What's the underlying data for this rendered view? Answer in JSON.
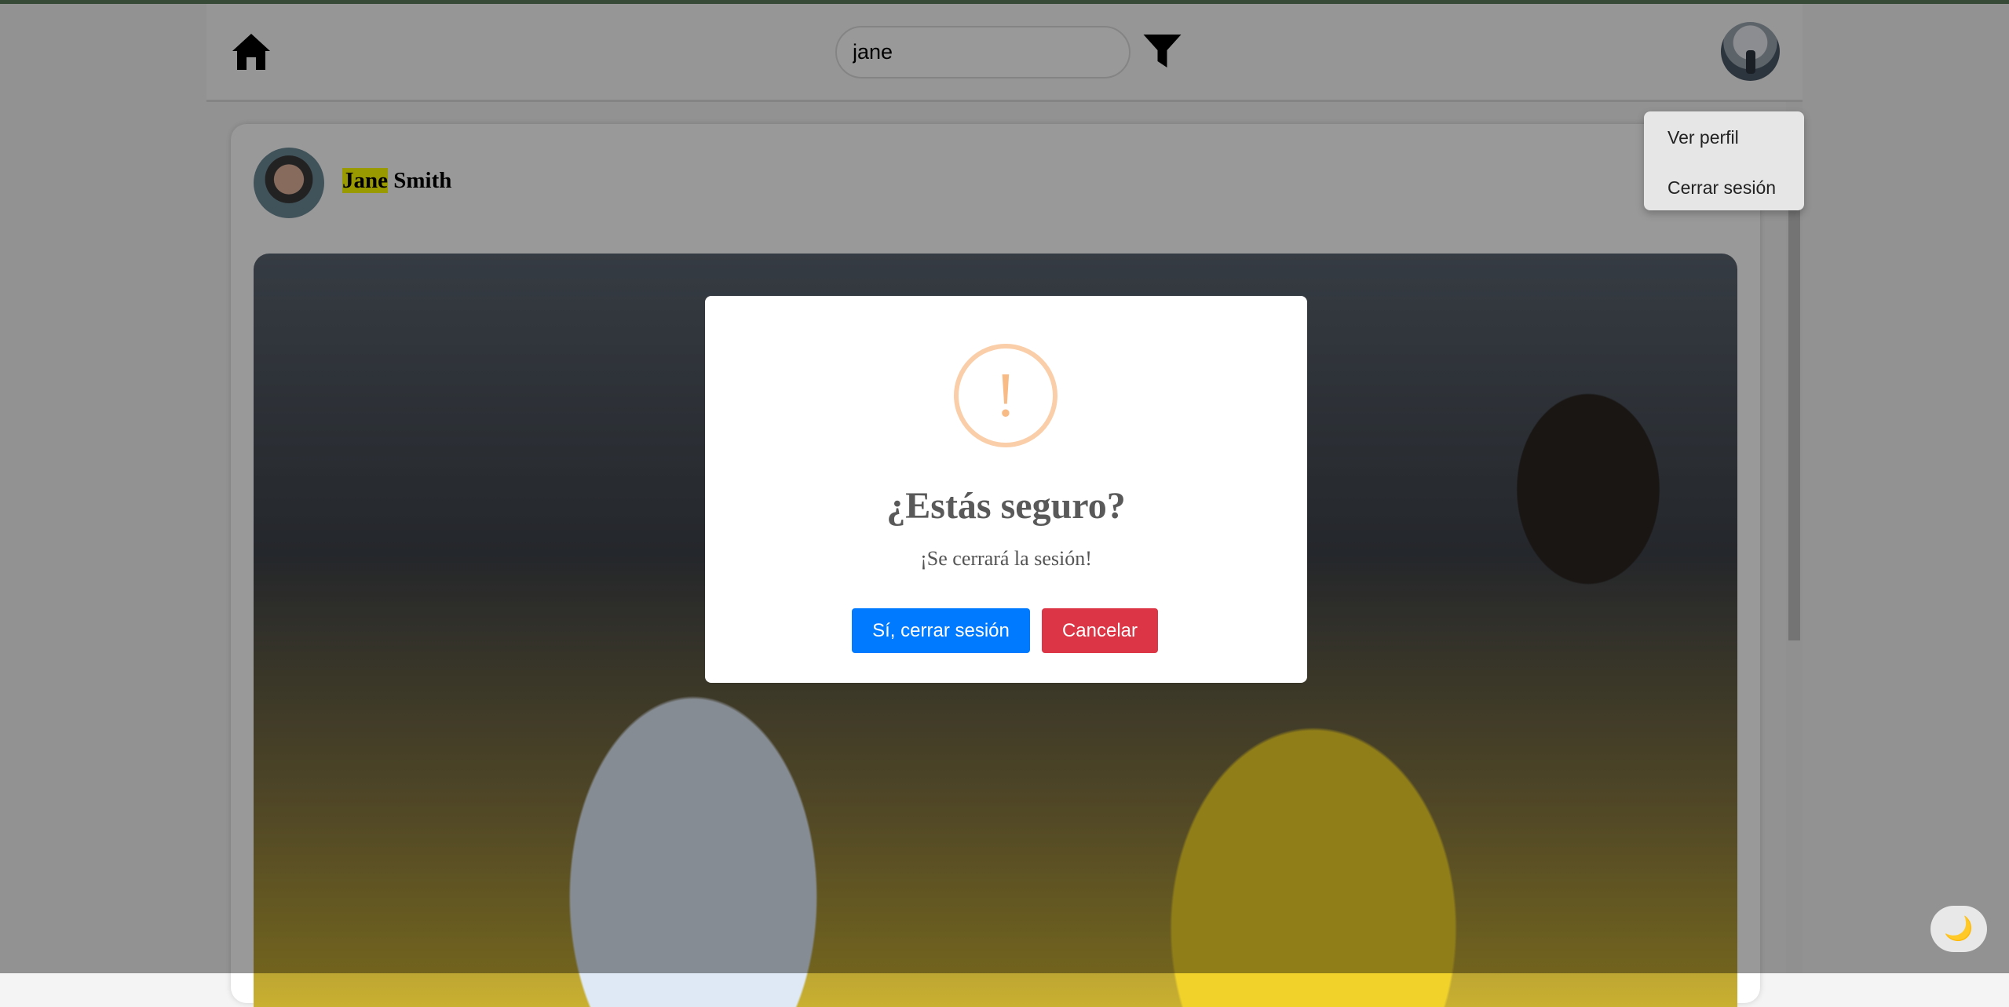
{
  "header": {
    "search": {
      "value": "jane",
      "placeholder": ""
    },
    "icons": {
      "home": "home-icon",
      "filter": "filter-icon",
      "avatar": "user-avatar"
    }
  },
  "profile_menu": {
    "items": [
      {
        "label": "Ver perfil"
      },
      {
        "label": "Cerrar sesión"
      }
    ]
  },
  "post": {
    "author_highlight": "Jane",
    "author_rest": " Smith"
  },
  "modal": {
    "icon": "warning-icon",
    "icon_glyph": "!",
    "title": "¿Estás seguro?",
    "text": "¡Se cerrará la sesión!",
    "confirm_label": "Sí, cerrar sesión",
    "cancel_label": "Cancelar"
  },
  "theme_toggle": {
    "icon": "moon-icon",
    "glyph": "🌙"
  },
  "colors": {
    "confirm": "#007bff",
    "cancel": "#dc3545",
    "warning": "#f8bb86",
    "highlight": "#ffff00"
  }
}
